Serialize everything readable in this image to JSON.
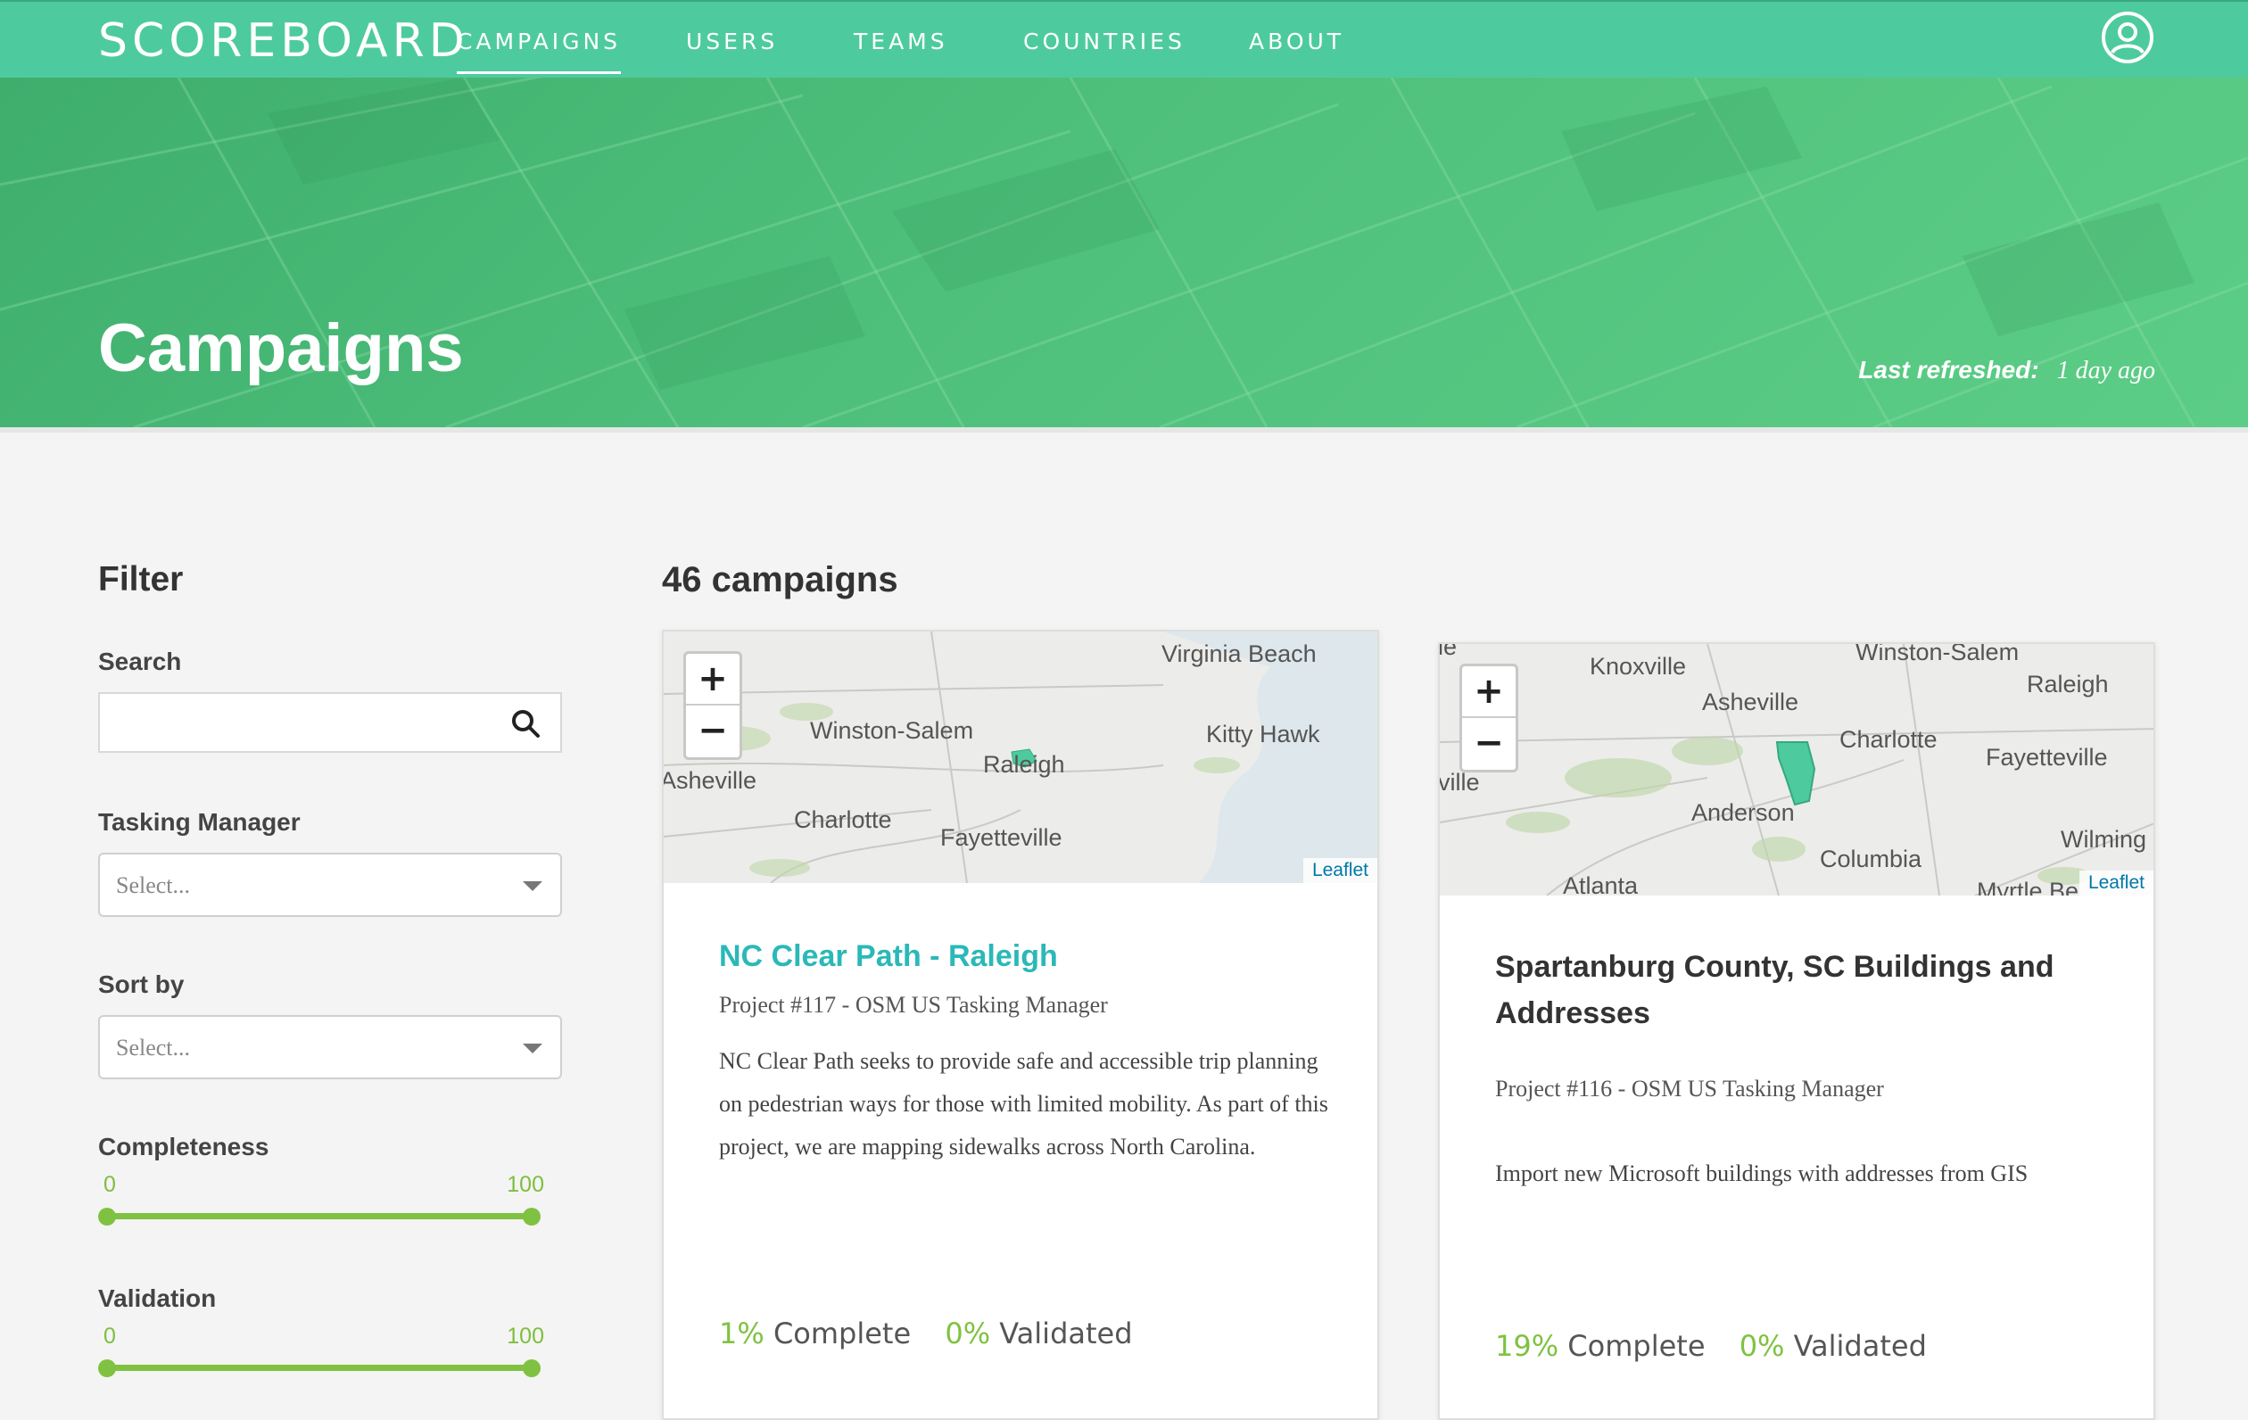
{
  "nav": {
    "brand": "SCOREBOARD",
    "items": [
      {
        "label": "CAMPAIGNS",
        "active": true
      },
      {
        "label": "USERS"
      },
      {
        "label": "TEAMS"
      },
      {
        "label": "COUNTRIES"
      },
      {
        "label": "ABOUT"
      }
    ],
    "account_icon": "user-circle-icon"
  },
  "hero": {
    "title": "Campaigns",
    "refreshed_label": "Last refreshed:",
    "refreshed_value": "1 day ago"
  },
  "filter": {
    "title": "Filter",
    "search_label": "Search",
    "search_placeholder": "",
    "search_icon": "search-icon",
    "tasking_manager_label": "Tasking Manager",
    "tasking_manager_placeholder": "Select...",
    "sort_label": "Sort by",
    "sort_placeholder": "Select...",
    "completeness": {
      "label": "Completeness",
      "min": "0",
      "max": "100"
    },
    "validation": {
      "label": "Validation",
      "min": "0",
      "max": "100"
    }
  },
  "main": {
    "count_text": "46 campaigns",
    "cards": [
      {
        "title": "NC Clear Path - Raleigh",
        "project": "Project #117 - OSM US Tasking Manager",
        "description": "NC Clear Path seeks to provide safe and accessible trip planning on pedestrian ways for those with limited mobility. As part of this project, we are mapping sidewalks across North Carolina.",
        "complete_pct": "1%",
        "complete_label": "Complete",
        "validated_pct": "0%",
        "validated_label": "Validated",
        "map": {
          "cities": [
            "Virginia Beach",
            "Winston-Salem",
            "Kitty Hawk",
            "Raleigh",
            "Asheville",
            "Charlotte",
            "Fayetteville"
          ],
          "attribution": "Leaflet"
        }
      },
      {
        "title": "Spartanburg County, SC Buildings and Addresses",
        "project": "Project #116 - OSM US Tasking Manager",
        "description": "Import new Microsoft buildings with addresses from GIS",
        "complete_pct": "19%",
        "complete_label": "Complete",
        "validated_pct": "0%",
        "validated_label": "Validated",
        "map": {
          "cities": [
            "Knoxville",
            "Winston-Salem",
            "Raleigh",
            "Asheville",
            "Charlotte",
            "Fayetteville",
            "Anderson",
            "Wilming",
            "Columbia",
            "Atlanta",
            "Myrtle Be",
            "ville",
            "le"
          ],
          "attribution": "Leaflet"
        }
      }
    ],
    "zoom_in": "+",
    "zoom_out": "−"
  },
  "colors": {
    "nav_bg": "#4ecb9e",
    "hero_green": "#4fc07c",
    "accent_green": "#7fc241",
    "link_teal": "#2bb8b8"
  }
}
